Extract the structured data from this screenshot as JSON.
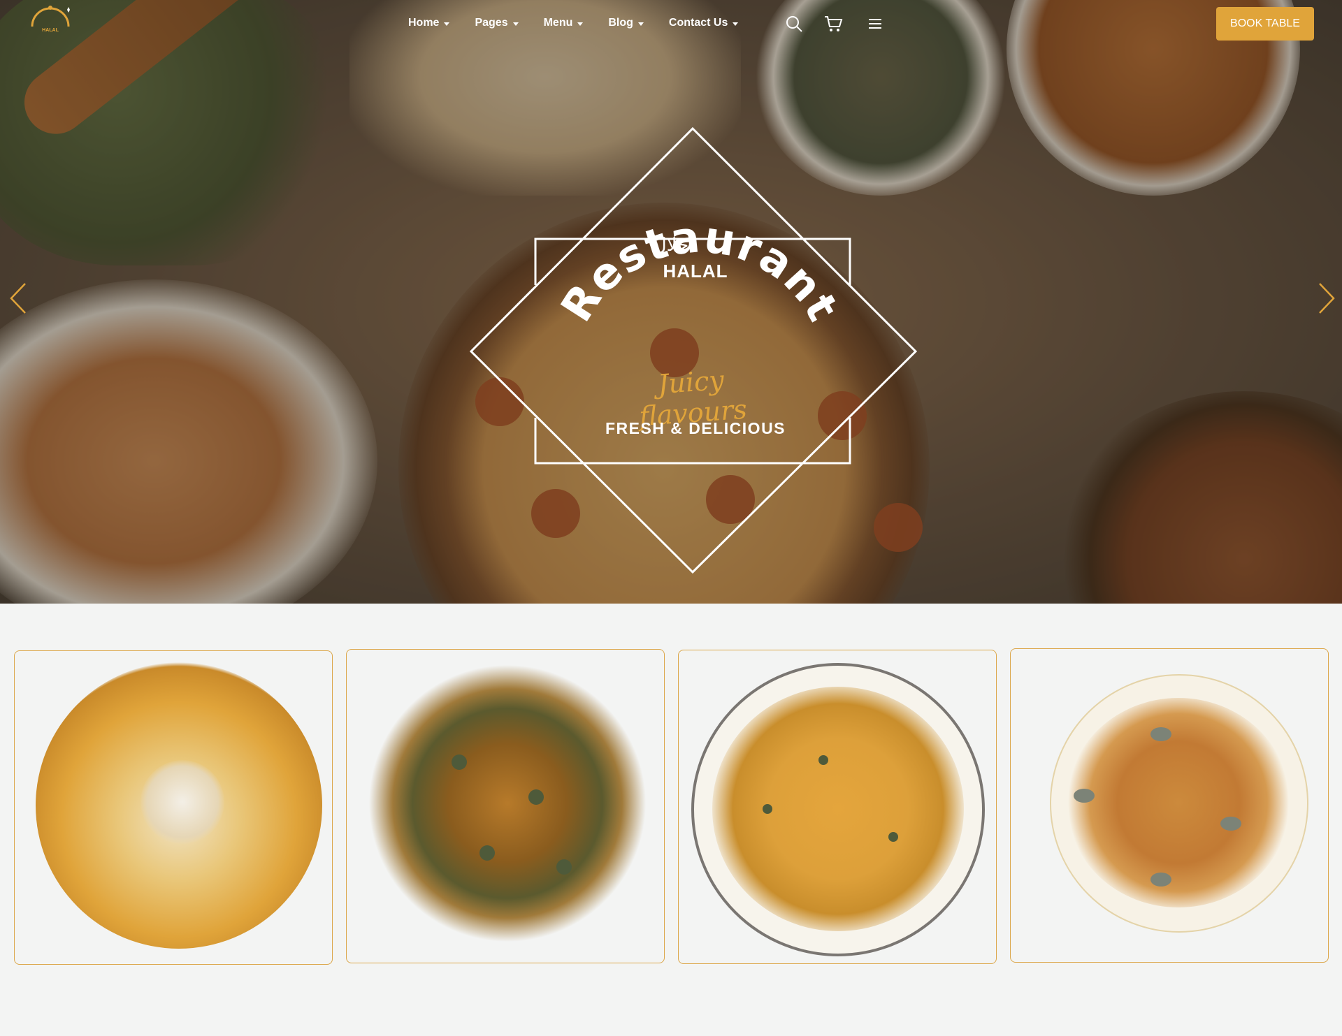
{
  "logo": {
    "text": "HALAL"
  },
  "nav": {
    "items": [
      {
        "label": "Home"
      },
      {
        "label": "Pages"
      },
      {
        "label": "Menu"
      },
      {
        "label": "Blog"
      },
      {
        "label": "Contact Us"
      }
    ],
    "icons": [
      "search-icon",
      "cart-icon",
      "hamburger-menu-icon"
    ]
  },
  "header": {
    "cta_label": "BOOK TABLE"
  },
  "hero": {
    "arabic": "حلال",
    "brand": "HALAL",
    "title": "Restaurant",
    "script": "Juicy flavours",
    "tagline": "FRESH & DELICIOUS",
    "prev_icon": "chevron-left-icon",
    "next_icon": "chevron-right-icon"
  },
  "colors": {
    "accent": "#e0a43a",
    "card_border": "#dca74a",
    "page_bg": "#f3f4f3"
  },
  "cards": [
    {
      "image": "shrimp-rice-platter"
    },
    {
      "image": "herb-stir-fry"
    },
    {
      "image": "fusilli-pasta-plate"
    },
    {
      "image": "spaghetti-with-basil"
    }
  ]
}
